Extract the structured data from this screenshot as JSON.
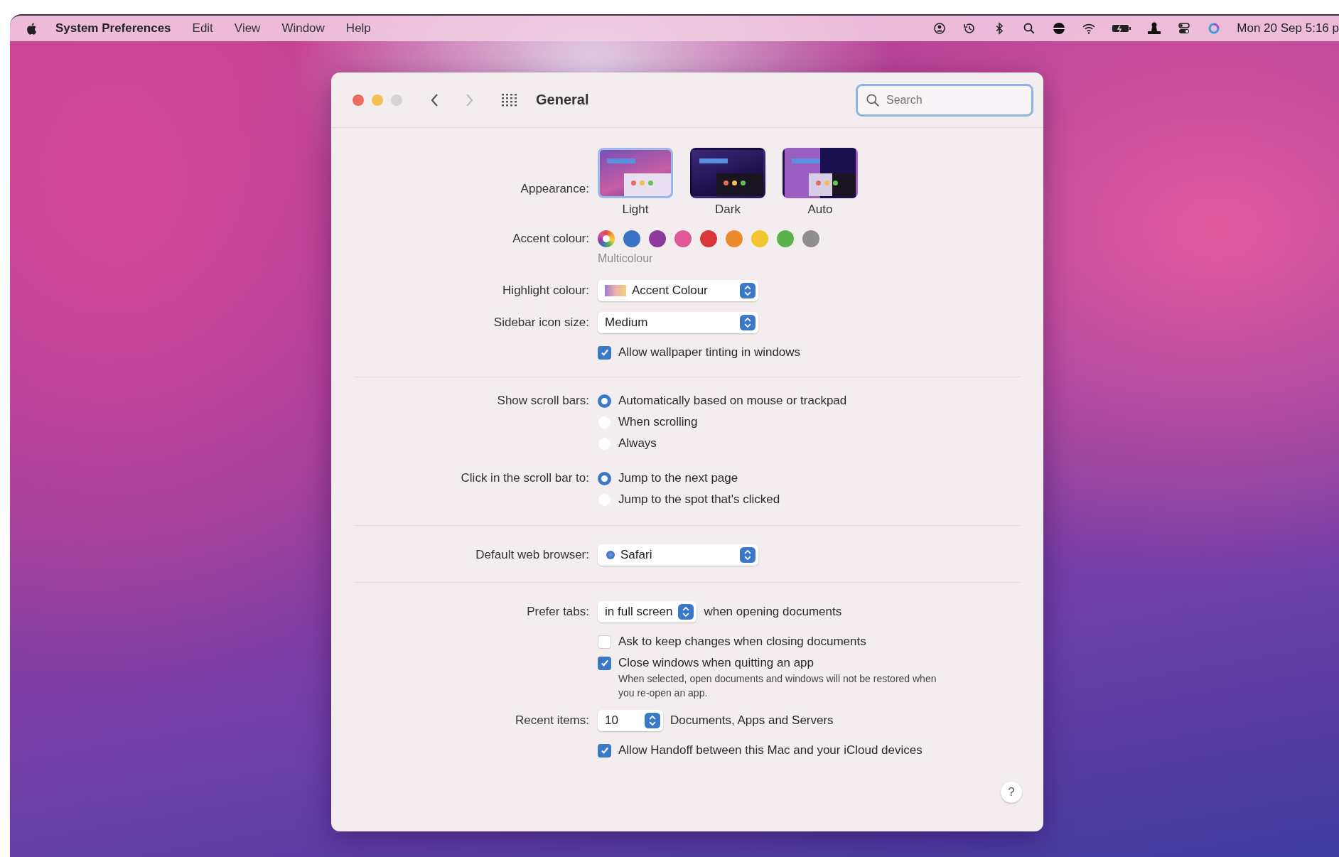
{
  "menu_bar": {
    "app_name": "System Preferences",
    "menus": [
      "Edit",
      "View",
      "Window",
      "Help"
    ],
    "clock": "Mon 20 Sep 5:16 p"
  },
  "window": {
    "title": "General",
    "search": {
      "placeholder": "Search"
    },
    "traffic_lights": [
      {
        "kind": "close",
        "disabled": false
      },
      {
        "kind": "minimize",
        "disabled": false
      },
      {
        "kind": "zoom",
        "disabled": true
      }
    ],
    "nav": [
      {
        "kind": "back",
        "disabled": false
      },
      {
        "kind": "forward",
        "disabled": true
      }
    ],
    "sections": [
      {
        "rows": [
          {
            "kind": "appearance",
            "label": "Appearance:",
            "options": [
              {
                "kind": "light",
                "label": "Light",
                "selected": true
              },
              {
                "kind": "dark",
                "label": "Dark",
                "selected": false
              },
              {
                "kind": "auto",
                "label": "Auto",
                "selected": false
              }
            ]
          },
          {
            "kind": "accent",
            "label": "Accent colour:",
            "caption": "Multicolour",
            "swatches": [
              {
                "kind": "multi",
                "selected": true
              },
              {
                "kind": "solid",
                "color": "#3b74c4",
                "selected": false
              },
              {
                "kind": "solid",
                "color": "#8e3a9c",
                "selected": false
              },
              {
                "kind": "solid",
                "color": "#e2569a",
                "selected": false
              },
              {
                "kind": "solid",
                "color": "#d9363e",
                "selected": false
              },
              {
                "kind": "solid",
                "color": "#ee8a2e",
                "selected": false
              },
              {
                "kind": "solid",
                "color": "#f3c52f",
                "selected": false
              },
              {
                "kind": "solid",
                "color": "#5bb24a",
                "selected": false
              },
              {
                "kind": "solid",
                "color": "#8e8e8e",
                "selected": false
              }
            ]
          },
          {
            "kind": "colour-popup",
            "label": "Highlight colour:",
            "value": "Accent Colour"
          },
          {
            "kind": "popup",
            "label": "Sidebar icon size:",
            "value": "Medium"
          },
          {
            "kind": "checkbox",
            "text": "Allow wallpaper tinting in windows",
            "checked": true
          }
        ]
      },
      {
        "rows": [
          {
            "kind": "radios",
            "label": "Show scroll bars:",
            "options": [
              {
                "label": "Automatically based on mouse or trackpad",
                "selected": true
              },
              {
                "label": "When scrolling",
                "selected": false
              },
              {
                "label": "Always",
                "selected": false
              }
            ]
          },
          {
            "kind": "radios",
            "label": "Click in the scroll bar to:",
            "options": [
              {
                "label": "Jump to the next page",
                "selected": true
              },
              {
                "label": "Jump to the spot that's clicked",
                "selected": false
              }
            ]
          }
        ]
      },
      {
        "rows": [
          {
            "kind": "browser-popup",
            "label": "Default web browser:",
            "value": "Safari"
          }
        ]
      },
      {
        "rows": [
          {
            "kind": "popup",
            "label": "Prefer tabs:",
            "value": "in full screen",
            "suffix": "when opening documents"
          },
          {
            "kind": "checkbox",
            "text": "Ask to keep changes when closing documents",
            "checked": false
          },
          {
            "kind": "checkbox",
            "text": "Close windows when quitting an app",
            "checked": true,
            "note": "When selected, open documents and windows will not be restored when you re-open an app."
          },
          {
            "kind": "popup",
            "label": "Recent items:",
            "value": "10",
            "suffix": "Documents, Apps and Servers"
          },
          {
            "kind": "checkbox",
            "text": "Allow Handoff between this Mac and your iCloud devices",
            "checked": true
          }
        ]
      }
    ],
    "help": "?"
  }
}
